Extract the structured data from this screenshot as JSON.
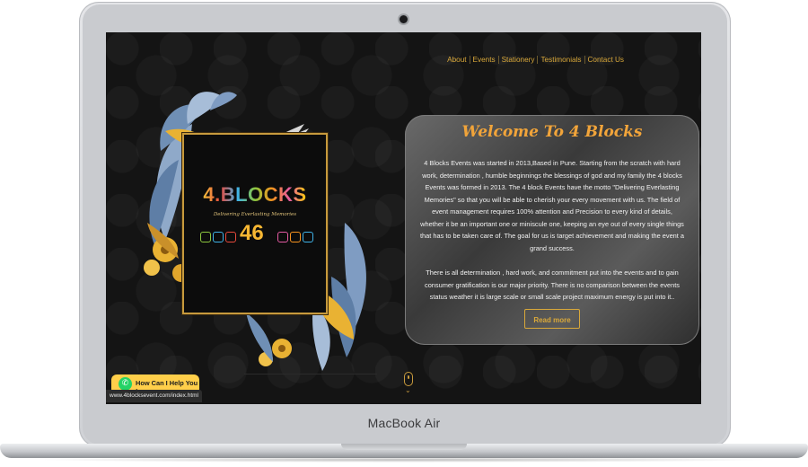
{
  "device": {
    "label": "MacBook Air"
  },
  "nav": {
    "items": [
      "About",
      "Events",
      "Stationery",
      "Testimonials",
      "Contact Us"
    ]
  },
  "logo": {
    "title": "4.BLOCKS",
    "tagline": "Delivering Everlasting Memories",
    "number": "46"
  },
  "welcome": {
    "heading": "Welcome To 4 Blocks",
    "paragraph1": "4 Blocks Events was started in 2013,Based in Pune. Starting from the scratch with hard work, determination , humble beginnings the blessings of god and my family the 4 blocks Events was formed in 2013. The 4 block Events have the motto \"Delivering Everlasting Memories\" so that you will be able to cherish your every movement with us. The field of event management requires 100% attention and Precision to every kind of details, whether it be an important one or miniscule one, keeping an eye out of every single things that has to be taken care of. The goal for us is target achievement and making the event a grand success.",
    "paragraph2": "There is all determination , hard work, and commitment put into the events and to gain consumer gratification is our major priority. There is no comparison between the events status weather it is large scale or small scale project maximum energy is put into it..",
    "button": "Read more"
  },
  "help": {
    "label": "How Can I Help You !"
  },
  "status_url": "www.4blocksevent.com/index.html",
  "colors": {
    "accent": "#d9a83a",
    "heading": "#f1a43a",
    "screen_bg": "#141414",
    "help_bg": "#ffcf4a"
  }
}
